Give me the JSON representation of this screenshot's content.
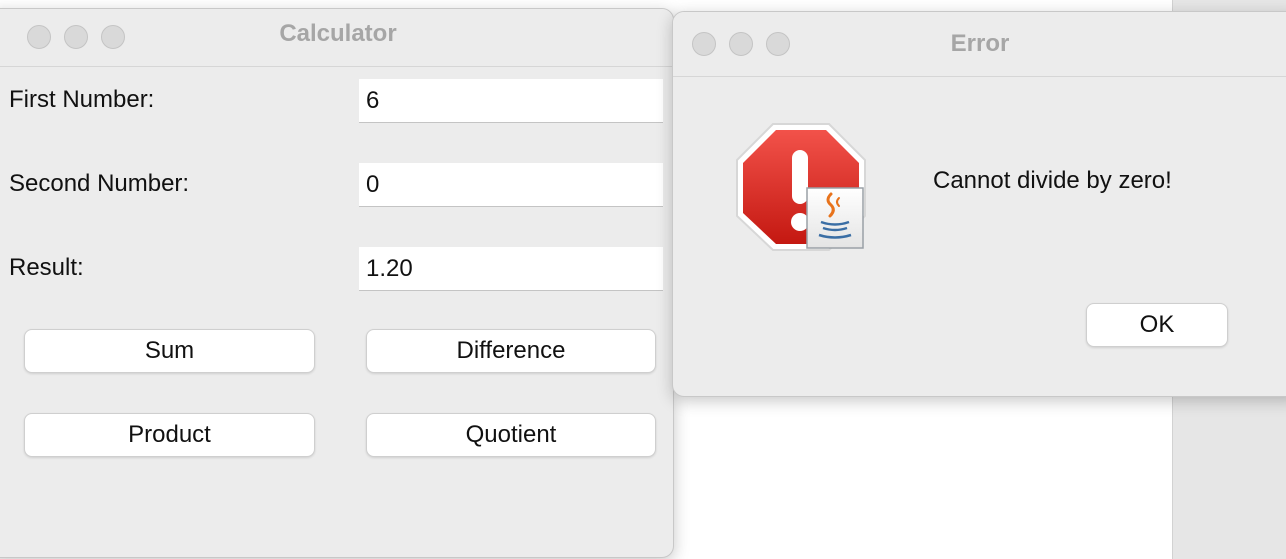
{
  "calculator": {
    "title": "Calculator",
    "fields": [
      {
        "label": "First Number:",
        "value": "6"
      },
      {
        "label": "Second Number:",
        "value": "0"
      },
      {
        "label": "Result:",
        "value": "1.20"
      }
    ],
    "buttons": {
      "sum": "Sum",
      "difference": "Difference",
      "product": "Product",
      "quotient": "Quotient"
    }
  },
  "error_dialog": {
    "title": "Error",
    "message": "Cannot divide by zero!",
    "ok_label": "OK",
    "icon": "error-stop-icon",
    "badge_icon": "java-cup-icon"
  },
  "colors": {
    "window_bg": "#ececec",
    "stop_red": "#d8231c",
    "title_text": "#a6a6a6"
  }
}
